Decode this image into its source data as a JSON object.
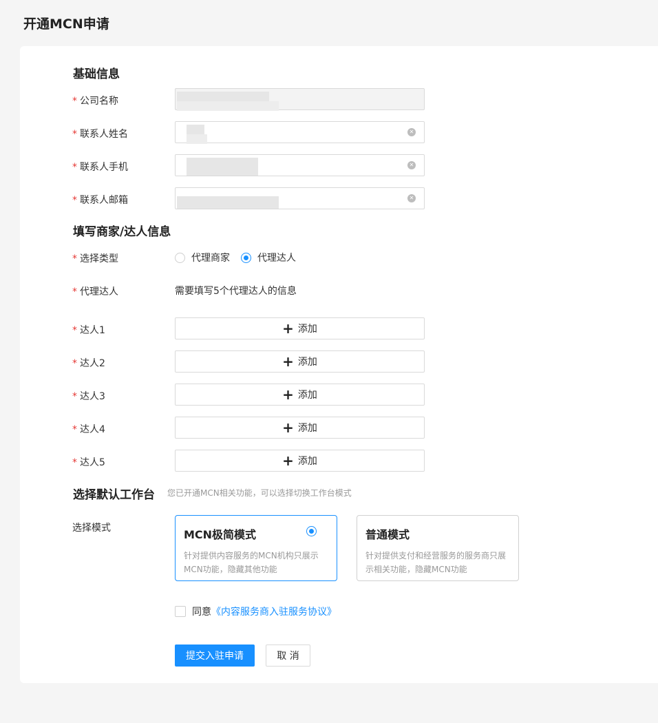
{
  "page": {
    "title": "开通MCN申请"
  },
  "basic_info": {
    "title": "基础信息",
    "fields": [
      {
        "label": "公司名称",
        "required": true
      },
      {
        "label": "联系人姓名",
        "required": true
      },
      {
        "label": "联系人手机",
        "required": true
      },
      {
        "label": "联系人邮箱",
        "required": true
      }
    ]
  },
  "merchant_info": {
    "title": "填写商家/达人信息",
    "type_label": "选择类型",
    "type_options": [
      "代理商家",
      "代理达人"
    ],
    "type_selected": "代理达人",
    "agent_label": "代理达人",
    "agent_helper": "需要填写5个代理达人的信息",
    "talents": [
      {
        "label": "达人1",
        "button": "添加"
      },
      {
        "label": "达人2",
        "button": "添加"
      },
      {
        "label": "达人3",
        "button": "添加"
      },
      {
        "label": "达人4",
        "button": "添加"
      },
      {
        "label": "达人5",
        "button": "添加"
      }
    ]
  },
  "workbench": {
    "title": "选择默认工作台",
    "subtitle": "您已开通MCN相关功能，可以选择切换工作台模式",
    "mode_label": "选择模式",
    "modes": [
      {
        "title": "MCN极简模式",
        "desc": "针对提供内容服务的MCN机构只展示MCN功能，隐藏其他功能",
        "selected": true
      },
      {
        "title": "普通模式",
        "desc": "针对提供支付和经营服务的服务商只展示相关功能，隐藏MCN功能",
        "selected": false
      }
    ]
  },
  "agreement": {
    "prefix": "同意",
    "link": "《内容服务商入驻服务协议》",
    "checked": false
  },
  "actions": {
    "submit": "提交入驻申请",
    "cancel": "取 消"
  },
  "icons": {
    "clear": "clear-icon",
    "plus": "plus-icon",
    "check": "checkbox"
  },
  "colors": {
    "accent": "#1890ff",
    "required": "#e53935"
  }
}
